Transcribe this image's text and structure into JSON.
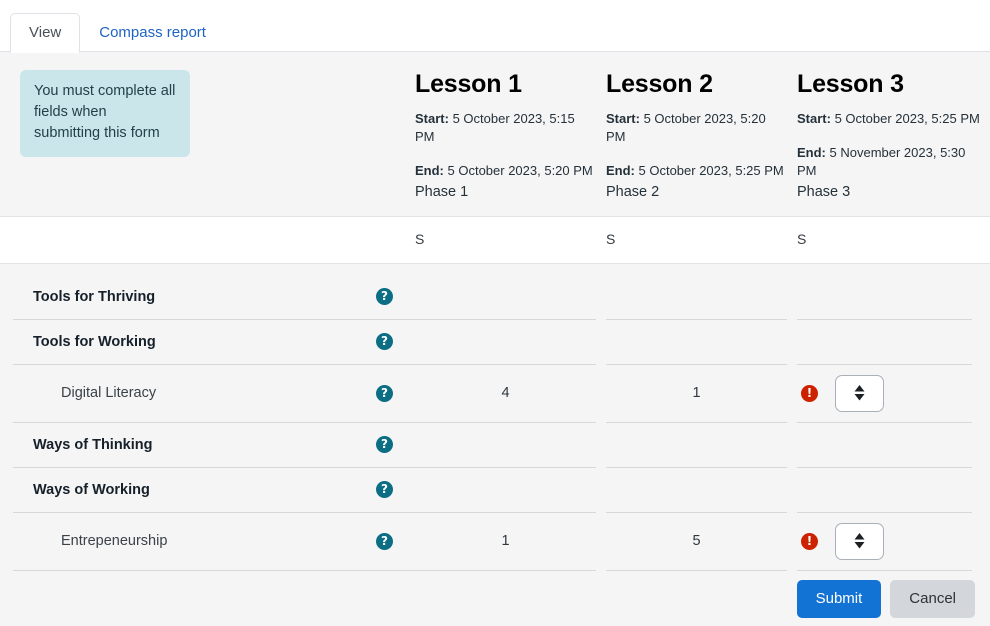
{
  "tabs": [
    {
      "label": "View",
      "active": true
    },
    {
      "label": "Compass report",
      "active": false
    }
  ],
  "notice": {
    "text": "You must complete all fields when submitting this form",
    "bg_color": "#cbe6ea"
  },
  "lessons": [
    {
      "title": "Lesson 1",
      "start_label": "Start:",
      "start_value": " 5 October 2023, 5:15 PM",
      "end_label": "End:",
      "end_value": " 5 October 2023, 5:20 PM",
      "phase": "Phase 1",
      "subheader": "S"
    },
    {
      "title": "Lesson 2",
      "start_label": "Start:",
      "start_value": " 5 October 2023, 5:20 PM",
      "end_label": "End:",
      "end_value": " 5 October 2023, 5:25 PM",
      "phase": "Phase 2",
      "subheader": "S"
    },
    {
      "title": "Lesson 3",
      "start_label": "Start:",
      "start_value": " 5 October 2023, 5:25 PM",
      "end_label": "End:",
      "end_value": " 5 November 2023, 5:30 PM",
      "phase": "Phase 3",
      "subheader": "S"
    }
  ],
  "help_icon": "?",
  "error_icon": "!",
  "rows": [
    {
      "label": "Tools for Thriving",
      "type": "group",
      "values": [
        "",
        "",
        ""
      ],
      "has_select": false,
      "has_error": false
    },
    {
      "label": "Tools for Working",
      "type": "group",
      "values": [
        "",
        "",
        ""
      ],
      "has_select": false,
      "has_error": false
    },
    {
      "label": "Digital Literacy",
      "type": "child",
      "values": [
        "4",
        "1",
        ""
      ],
      "has_select": true,
      "has_error": true
    },
    {
      "label": "Ways of Thinking",
      "type": "group",
      "values": [
        "",
        "",
        ""
      ],
      "has_select": false,
      "has_error": false
    },
    {
      "label": "Ways of Working",
      "type": "group",
      "values": [
        "",
        "",
        ""
      ],
      "has_select": false,
      "has_error": false
    },
    {
      "label": "Entrepeneurship",
      "type": "child",
      "values": [
        "1",
        "5",
        ""
      ],
      "has_select": true,
      "has_error": true
    }
  ],
  "footer": {
    "submit_label": "Submit",
    "cancel_label": "Cancel",
    "submit_color": "#1273d4",
    "cancel_color": "#d3d6da"
  }
}
